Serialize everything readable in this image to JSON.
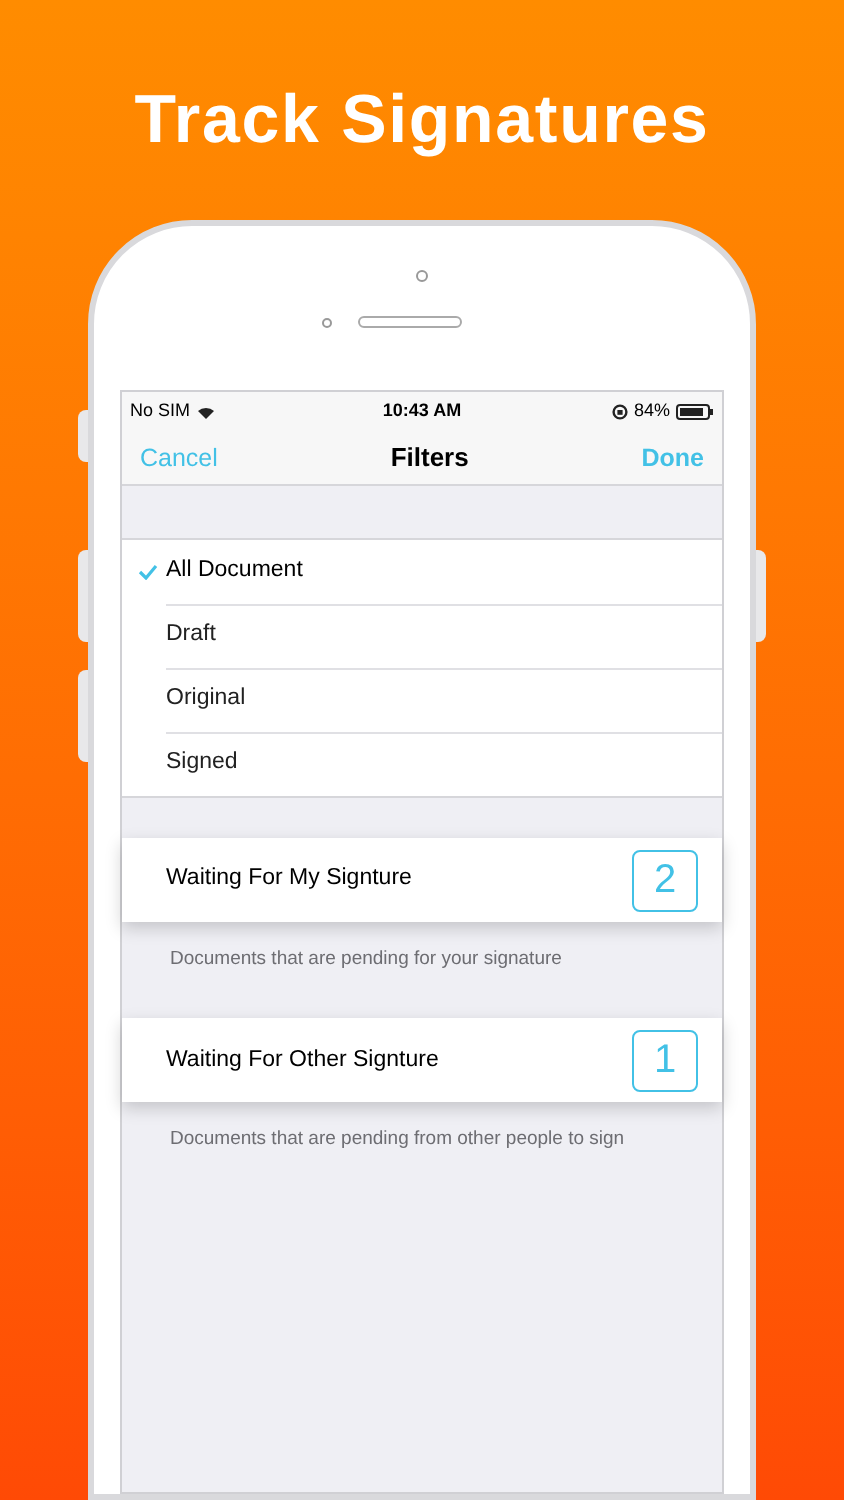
{
  "headline": "Track Signatures",
  "status_bar": {
    "carrier": "No SIM",
    "time": "10:43 AM",
    "battery": "84%"
  },
  "nav": {
    "left": "Cancel",
    "title": "Filters",
    "right": "Done"
  },
  "filters": [
    {
      "label": "All Document",
      "selected": true
    },
    {
      "label": "Draft",
      "selected": false
    },
    {
      "label": "Original",
      "selected": false
    },
    {
      "label": "Signed",
      "selected": false
    }
  ],
  "sections": [
    {
      "title": "Waiting For My Signture",
      "count": "2",
      "footer": "Documents that are pending for your signature"
    },
    {
      "title": "Waiting For Other Signture",
      "count": "1",
      "footer": "Documents that are pending from other people to sign"
    }
  ]
}
